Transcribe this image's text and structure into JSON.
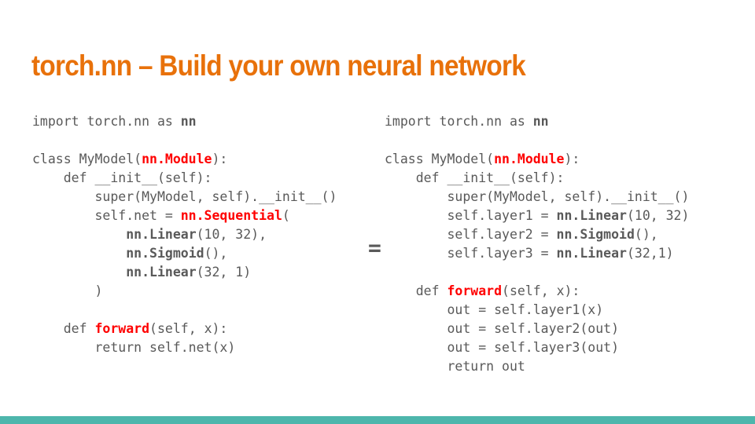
{
  "slide": {
    "title": "torch.nn – Build your own neural network",
    "equals_symbol": "="
  },
  "colors": {
    "title": "#e8710a",
    "code_text": "#595959",
    "highlight_red": "#ff0000",
    "bottom_bar": "#4db6ac"
  },
  "code_left": [
    [
      {
        "t": "import torch.nn as "
      },
      {
        "t": "nn",
        "s": "bold"
      }
    ],
    [],
    [
      {
        "t": "class MyModel("
      },
      {
        "t": "nn.Module",
        "s": "red"
      },
      {
        "t": "):"
      }
    ],
    [
      {
        "t": "    def __init__(self):"
      }
    ],
    [
      {
        "t": "        super(MyModel, self).__init__()"
      }
    ],
    [
      {
        "t": "        self.net = "
      },
      {
        "t": "nn.Sequential",
        "s": "red"
      },
      {
        "t": "("
      }
    ],
    [
      {
        "t": "            "
      },
      {
        "t": "nn.Linear",
        "s": "bold"
      },
      {
        "t": "(10, 32),"
      }
    ],
    [
      {
        "t": "            "
      },
      {
        "t": "nn.Sigmoid",
        "s": "bold"
      },
      {
        "t": "(),"
      }
    ],
    [
      {
        "t": "            "
      },
      {
        "t": "nn.Linear",
        "s": "bold"
      },
      {
        "t": "(32, 1)"
      }
    ],
    [
      {
        "t": "        )"
      }
    ],
    [],
    [
      {
        "t": "    def "
      },
      {
        "t": "forward",
        "s": "red"
      },
      {
        "t": "(self, x):"
      }
    ],
    [
      {
        "t": "        return self.net(x)"
      }
    ]
  ],
  "code_right": [
    [
      {
        "t": "import torch.nn as "
      },
      {
        "t": "nn",
        "s": "bold"
      }
    ],
    [],
    [
      {
        "t": "class MyModel("
      },
      {
        "t": "nn.Module",
        "s": "red"
      },
      {
        "t": "):"
      }
    ],
    [
      {
        "t": "    def __init__(self):"
      }
    ],
    [
      {
        "t": "        super(MyModel, self).__init__()"
      }
    ],
    [
      {
        "t": "        self.layer1 = "
      },
      {
        "t": "nn.Linear",
        "s": "bold"
      },
      {
        "t": "(10, 32)"
      }
    ],
    [
      {
        "t": "        self.layer2 = "
      },
      {
        "t": "nn.Sigmoid",
        "s": "bold"
      },
      {
        "t": "(),"
      }
    ],
    [
      {
        "t": "        self.layer3 = "
      },
      {
        "t": "nn.Linear",
        "s": "bold"
      },
      {
        "t": "(32,1)"
      }
    ],
    [],
    [
      {
        "t": "    def "
      },
      {
        "t": "forward",
        "s": "red"
      },
      {
        "t": "(self, x):"
      }
    ],
    [
      {
        "t": "        out = self.layer1(x)"
      }
    ],
    [
      {
        "t": "        out = self.layer2(out)"
      }
    ],
    [
      {
        "t": "        out = self.layer3(out)"
      }
    ],
    [
      {
        "t": "        return out"
      }
    ]
  ]
}
